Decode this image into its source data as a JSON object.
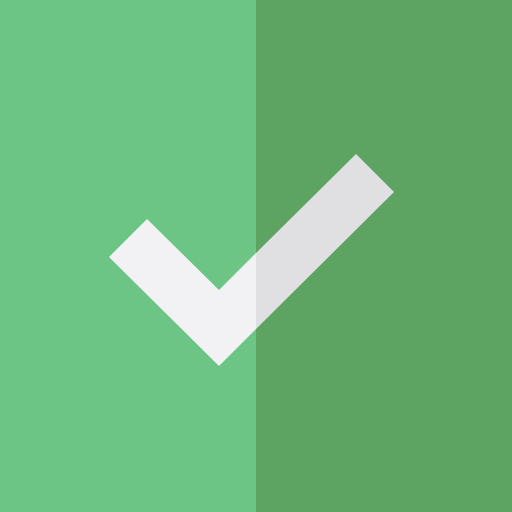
{
  "icon": {
    "name": "checkmark-icon",
    "colors": {
      "left_background": "#6CC485",
      "right_background": "#5DA361",
      "check_light": "#F2F2F4",
      "check_shaded": "#E0E0E2"
    }
  }
}
